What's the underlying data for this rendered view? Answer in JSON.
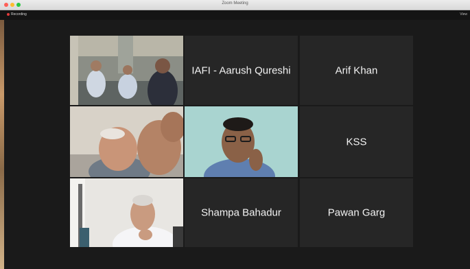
{
  "window": {
    "title": "Zoom Meeting"
  },
  "topbar": {
    "recording_label": "Recording",
    "view_label": "View"
  },
  "participants": [
    {
      "type": "video",
      "description": "conference room"
    },
    {
      "type": "name",
      "name": "IAFI - Aarush Qureshi"
    },
    {
      "type": "name",
      "name": "Arif Khan"
    },
    {
      "type": "video",
      "description": "participant close up"
    },
    {
      "type": "video",
      "description": "participant with glasses"
    },
    {
      "type": "name",
      "name": "KSS"
    },
    {
      "type": "video",
      "description": "participant in office"
    },
    {
      "type": "name",
      "name": "Shampa Bahadur"
    },
    {
      "type": "name",
      "name": "Pawan Garg"
    }
  ],
  "colors": {
    "active_speaker": "#2cd85a",
    "tile_bg": "#262626"
  }
}
